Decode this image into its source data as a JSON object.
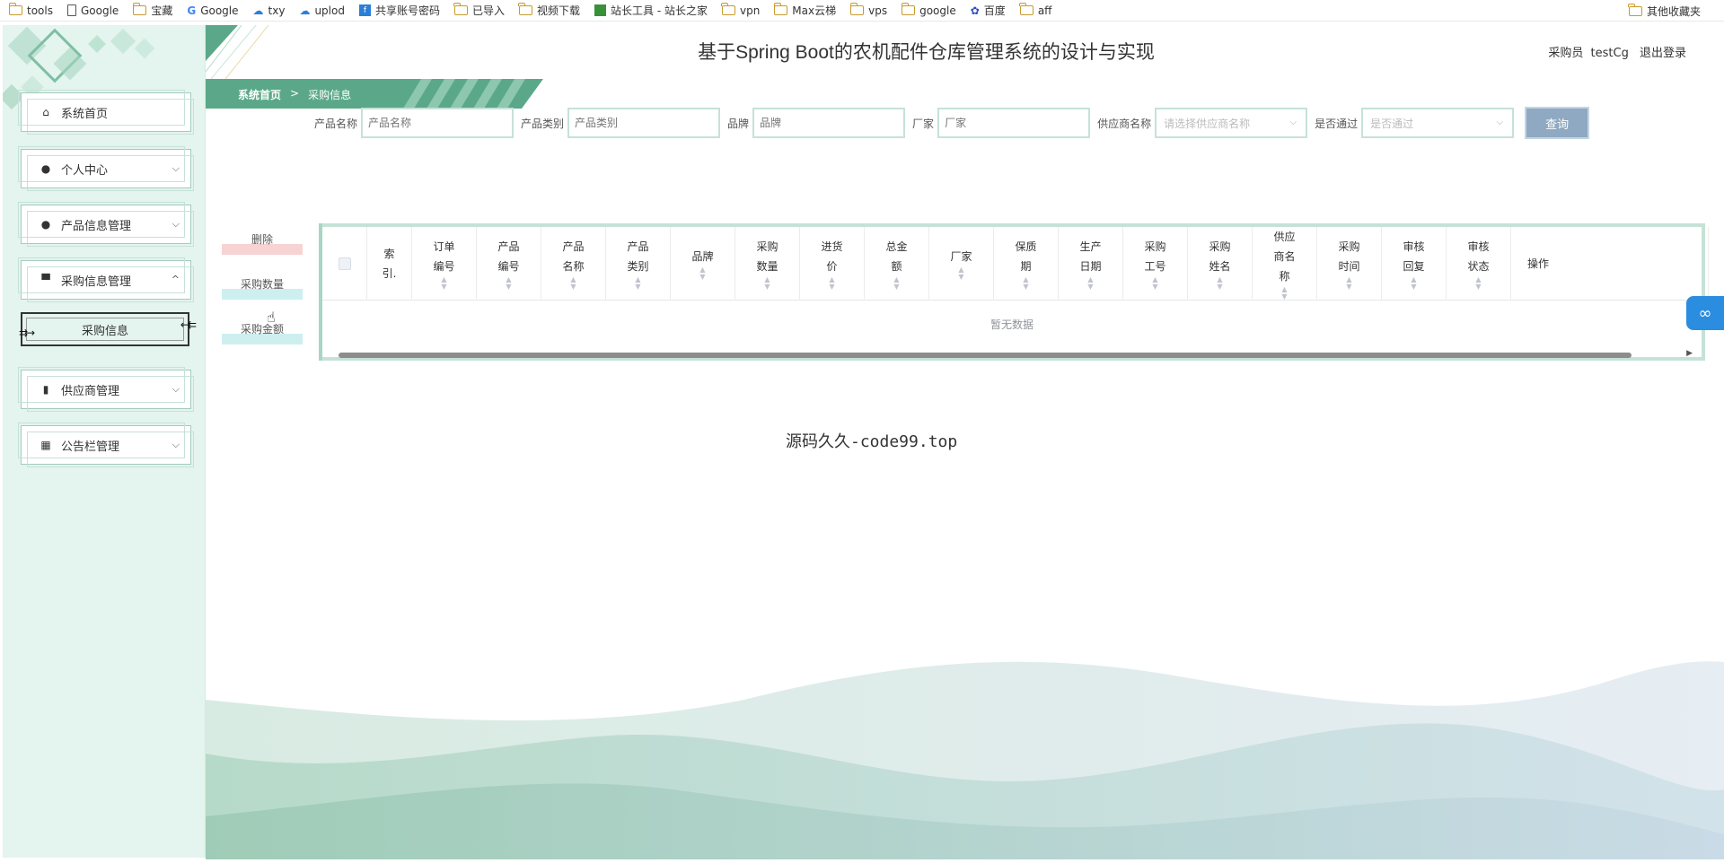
{
  "bookmarks": [
    {
      "label": "tools",
      "icon": "folder-icon"
    },
    {
      "label": "Google",
      "icon": "page-icon"
    },
    {
      "label": "宝藏",
      "icon": "folder-icon"
    },
    {
      "label": "Google",
      "icon": "google-icon"
    },
    {
      "label": "txy",
      "icon": "cloud-icon"
    },
    {
      "label": "uplod",
      "icon": "cloud-icon"
    },
    {
      "label": "共享账号密码",
      "icon": "fb-icon"
    },
    {
      "label": "已导入",
      "icon": "folder-icon"
    },
    {
      "label": "视频下载",
      "icon": "folder-icon"
    },
    {
      "label": "站长工具 - 站长之家",
      "icon": "tool-icon"
    },
    {
      "label": "vpn",
      "icon": "folder-icon"
    },
    {
      "label": "Max云梯",
      "icon": "folder-icon"
    },
    {
      "label": "vps",
      "icon": "folder-icon"
    },
    {
      "label": "google",
      "icon": "folder-icon"
    },
    {
      "label": "百度",
      "icon": "baidu-icon"
    },
    {
      "label": "aff",
      "icon": "folder-icon"
    }
  ],
  "bookmarks_other": "其他收藏夹",
  "header": {
    "title": "基于Spring Boot的农机配件仓库管理系统的设计与实现",
    "role": "采购员",
    "username": "testCg",
    "logout": "退出登录"
  },
  "breadcrumb": {
    "home": "系统首页",
    "separator": ">",
    "current": "采购信息"
  },
  "sidebar": {
    "items": [
      {
        "label": "系统首页",
        "icon": "home-icon",
        "has_chevron": false
      },
      {
        "label": "个人中心",
        "icon": "user-icon",
        "has_chevron": true
      },
      {
        "label": "产品信息管理",
        "icon": "user-icon",
        "has_chevron": true
      },
      {
        "label": "采购信息管理",
        "icon": "cart-icon",
        "has_chevron": true,
        "expanded": true
      },
      {
        "label": "供应商管理",
        "icon": "bar-chart-icon",
        "has_chevron": true
      },
      {
        "label": "公告栏管理",
        "icon": "grid-icon",
        "has_chevron": true
      }
    ],
    "sub_item": "采购信息"
  },
  "search": {
    "fields": [
      {
        "label": "产品名称",
        "placeholder": "产品名称"
      },
      {
        "label": "产品类别",
        "placeholder": "产品类别"
      },
      {
        "label": "品牌",
        "placeholder": "品牌"
      },
      {
        "label": "厂家",
        "placeholder": "厂家"
      }
    ],
    "supplier": {
      "label": "供应商名称",
      "placeholder": "请选择供应商名称"
    },
    "passed": {
      "label": "是否通过",
      "placeholder": "是否通过"
    },
    "query_button": "查询"
  },
  "actions": {
    "delete": "删除",
    "qty_stats": "采购数量",
    "amount_stats": "采购金额"
  },
  "table": {
    "columns": [
      [
        "索",
        "引."
      ],
      [
        "订单",
        "编号"
      ],
      [
        "产品",
        "编号"
      ],
      [
        "产品",
        "名称"
      ],
      [
        "产品",
        "类别"
      ],
      [
        "品牌"
      ],
      [
        "采购",
        "数量"
      ],
      [
        "进货",
        "价"
      ],
      [
        "总金",
        "额"
      ],
      [
        "厂家"
      ],
      [
        "保质",
        "期"
      ],
      [
        "生产",
        "日期"
      ],
      [
        "采购",
        "工号"
      ],
      [
        "采购",
        "姓名"
      ],
      [
        "供应",
        "商名",
        "称"
      ],
      [
        "采购",
        "时间"
      ],
      [
        "审核",
        "回复"
      ],
      [
        "审核",
        "状态"
      ]
    ],
    "operation": "操作",
    "empty": "暂无数据"
  },
  "watermark": "源码久久-code99.top",
  "colors": {
    "sidebar_bg": "#e4f4ee",
    "accent_green": "#5aa889",
    "query_button": "#8fa9c2",
    "delete_bar": "#f7d3d3",
    "stats_bar": "#cdeff0"
  }
}
